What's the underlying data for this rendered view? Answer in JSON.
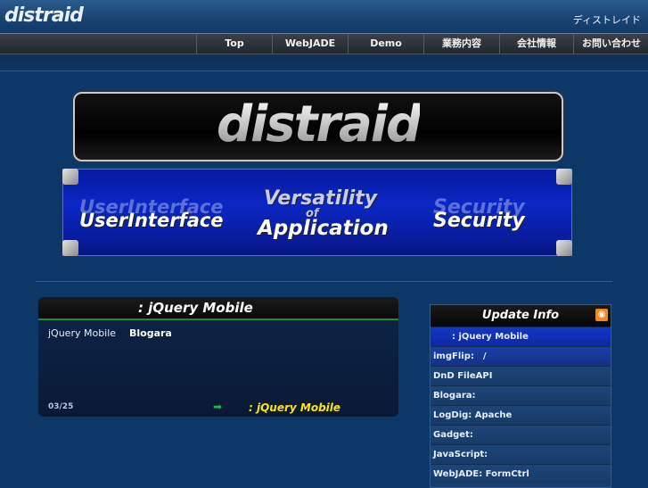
{
  "header": {
    "logo": "distraid",
    "kana": "ディストレイド"
  },
  "nav": {
    "items": [
      {
        "label": "Top"
      },
      {
        "label": "WebJADE"
      },
      {
        "label": "Demo"
      },
      {
        "label": "業務内容"
      },
      {
        "label": "会社情報"
      },
      {
        "label": "お問い合わせ"
      }
    ]
  },
  "hero": {
    "title": "distraid",
    "left_text": "UserInterface",
    "left_ghost": "UserInterface",
    "center_top": "Versatility",
    "center_mid": "of",
    "center_bottom": "Application",
    "right_text": "Security",
    "right_ghost": "Security"
  },
  "panel": {
    "title": ": jQuery Mobile",
    "line_label": "jQuery Mobile",
    "line_value": "Blogara",
    "date": "03/25",
    "arrow": "➡",
    "link": ": jQuery Mobile"
  },
  "sidebar": {
    "title": "Update Info",
    "rss_icon": "rss-icon",
    "items": [
      {
        "label": ": jQuery Mobile"
      },
      {
        "label": "imgFlip:　/"
      },
      {
        "label": "DnD  FileAPI"
      },
      {
        "label": "Blogara:"
      },
      {
        "label": "LogDig: Apache"
      },
      {
        "label": "Gadget:"
      },
      {
        "label": "JavaScript:"
      },
      {
        "label": "WebJADE: FormCtrl"
      }
    ]
  },
  "colors": {
    "page_bg": "#0d3766",
    "banner_blue": "#0b26c4",
    "link_yellow": "#ffe600",
    "accent_green": "#1e8a3a"
  }
}
